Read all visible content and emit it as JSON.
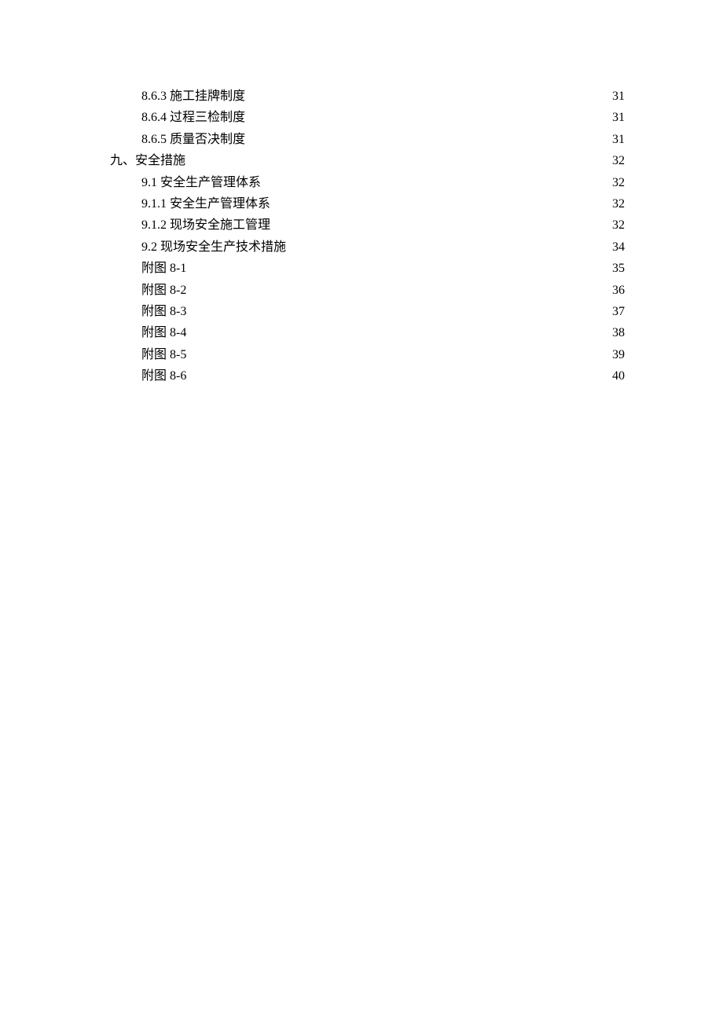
{
  "toc": [
    {
      "label": "8.6.3 施工挂牌制度",
      "page": "31",
      "indent": 2
    },
    {
      "label": "8.6.4 过程三检制度",
      "page": "31",
      "indent": 2
    },
    {
      "label": "8.6.5 质量否决制度",
      "page": "31",
      "indent": 2
    },
    {
      "label": "九、安全措施",
      "page": "32",
      "indent": 0
    },
    {
      "label": "9.1 安全生产管理体系",
      "page": "32",
      "indent": 1
    },
    {
      "label": "9.1.1 安全生产管理体系",
      "page": "32",
      "indent": 2
    },
    {
      "label": "9.1.2 现场安全施工管理",
      "page": "32",
      "indent": 2
    },
    {
      "label": "9.2 现场安全生产技术措施",
      "page": "34",
      "indent": 1
    },
    {
      "label": "附图 8-1",
      "page": "35",
      "indent": 1
    },
    {
      "label": "附图 8-2",
      "page": "36",
      "indent": 1
    },
    {
      "label": "附图 8-3",
      "page": "37",
      "indent": 1
    },
    {
      "label": "附图 8-4",
      "page": "38",
      "indent": 1
    },
    {
      "label": "附图 8-5",
      "page": "39",
      "indent": 1
    },
    {
      "label": "附图 8-6",
      "page": "40",
      "indent": 1
    }
  ]
}
